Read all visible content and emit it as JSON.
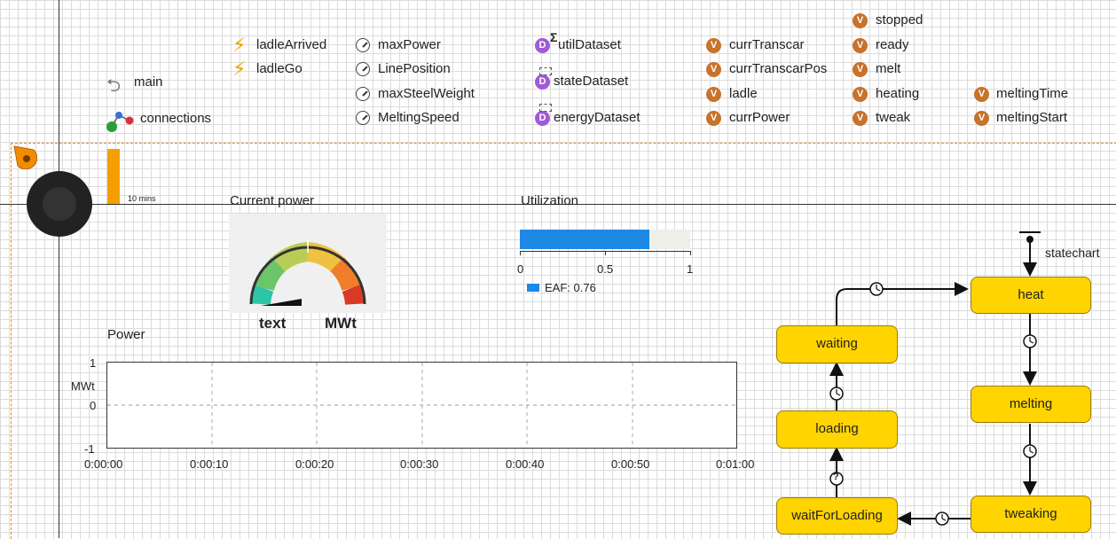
{
  "top_items": {
    "main": "main",
    "connections": "connections",
    "events": [
      "ladleArrived",
      "ladleGo"
    ],
    "params": [
      "maxPower",
      "LinePosition",
      "maxSteelWeight",
      "MeltingSpeed"
    ],
    "datasets": [
      "utilDataset",
      "stateDataset",
      "energyDataset"
    ],
    "vars_col1": [
      "currTranscar",
      "currTranscarPos",
      "ladle",
      "currPower"
    ],
    "vars_col2": [
      "stopped",
      "ready",
      "melt",
      "heating",
      "tweak"
    ],
    "vars_col3": [
      "meltingTime",
      "meltingStart"
    ],
    "icon_letters": {
      "variable": "V",
      "dataset": "D",
      "dataset_sigma": "Σ"
    }
  },
  "timescale": {
    "label": "10 mins"
  },
  "current_power": {
    "title": "Current power",
    "text_label": "text",
    "unit_label": "MWt"
  },
  "utilization": {
    "title": "Utilization",
    "value": 0.76,
    "ticks": [
      "0",
      "0.5",
      "1"
    ],
    "legend": "EAF: 0.76",
    "bar_color": "#1e88e5"
  },
  "power_chart": {
    "title": "Power",
    "ylabel": "MWt",
    "yticks": [
      "1",
      "0",
      "-1"
    ],
    "xticks": [
      "0:00:00",
      "0:00:10",
      "0:00:20",
      "0:00:30",
      "0:00:40",
      "0:00:50",
      "0:01:00"
    ]
  },
  "statechart": {
    "label": "statechart",
    "states": {
      "heat": "heat",
      "melting": "melting",
      "tweaking": "tweaking",
      "waitForLoading": "waitForLoading",
      "loading": "loading",
      "waiting": "waiting"
    },
    "state_color": "#ffd400",
    "transition_glyphs": {
      "timeout": "◷",
      "condition": "?"
    }
  }
}
